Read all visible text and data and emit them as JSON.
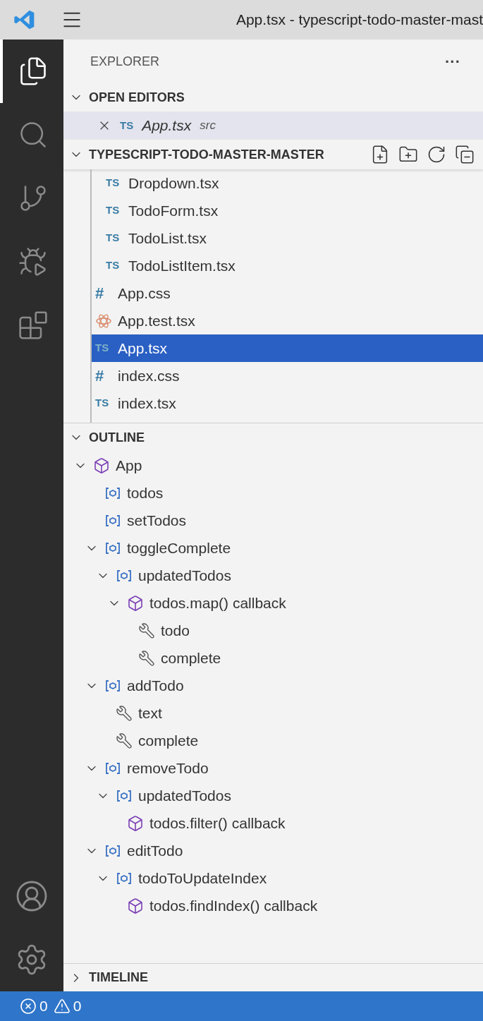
{
  "title_bar": {
    "title": "App.tsx - typescript-todo-master-mast"
  },
  "activity_bar": [
    {
      "kind": "explorer",
      "selected": true
    },
    {
      "kind": "search",
      "selected": false
    },
    {
      "kind": "scm",
      "selected": false
    },
    {
      "kind": "debug",
      "selected": false
    },
    {
      "kind": "extensions",
      "selected": false
    }
  ],
  "activity_bar_bottom": [
    {
      "kind": "account"
    },
    {
      "kind": "settings"
    }
  ],
  "explorer": {
    "title": "EXPLORER",
    "more": "···",
    "open_editors": {
      "label": "OPEN EDITORS",
      "expanded": true,
      "items": [
        {
          "icon": "TS",
          "name": "App.tsx",
          "folder": "src",
          "selected": true
        }
      ]
    },
    "folder": {
      "label": "TYPESCRIPT-TODO-MASTER-MASTER",
      "expanded": true,
      "nested_files": [
        {
          "kind": "ts",
          "icon": "TS",
          "name": "Dropdown.tsx",
          "selected": false
        },
        {
          "kind": "ts",
          "icon": "TS",
          "name": "TodoForm.tsx",
          "selected": false
        },
        {
          "kind": "ts",
          "icon": "TS",
          "name": "TodoList.tsx",
          "selected": false
        },
        {
          "kind": "ts",
          "icon": "TS",
          "name": "TodoListItem.tsx",
          "selected": false
        }
      ],
      "files": [
        {
          "kind": "css",
          "icon": "#",
          "name": "App.css",
          "selected": false
        },
        {
          "kind": "test",
          "name": "App.test.tsx",
          "selected": false
        },
        {
          "kind": "ts",
          "icon": "TS",
          "name": "App.tsx",
          "selected": true
        },
        {
          "kind": "css",
          "icon": "#",
          "name": "index.css",
          "selected": false
        },
        {
          "kind": "ts",
          "icon": "TS",
          "name": "index.tsx",
          "selected": false
        }
      ]
    }
  },
  "outline": {
    "label": "OUTLINE",
    "expanded": true,
    "items": [
      {
        "kind": "module",
        "name": "App",
        "expanded": true,
        "children": [
          {
            "kind": "variable",
            "name": "todos"
          },
          {
            "kind": "variable",
            "name": "setTodos"
          },
          {
            "kind": "variable",
            "name": "toggleComplete",
            "expanded": true,
            "children": [
              {
                "kind": "variable",
                "name": "updatedTodos",
                "expanded": true,
                "children": [
                  {
                    "kind": "module",
                    "name": "todos.map() callback",
                    "expanded": true,
                    "children": [
                      {
                        "kind": "property",
                        "name": "todo"
                      },
                      {
                        "kind": "property",
                        "name": "complete"
                      }
                    ]
                  }
                ]
              }
            ]
          },
          {
            "kind": "variable",
            "name": "addTodo",
            "expanded": true,
            "children": [
              {
                "kind": "property",
                "name": "text"
              },
              {
                "kind": "property",
                "name": "complete"
              }
            ]
          },
          {
            "kind": "variable",
            "name": "removeTodo",
            "expanded": true,
            "children": [
              {
                "kind": "variable",
                "name": "updatedTodos",
                "expanded": true,
                "children": [
                  {
                    "kind": "module",
                    "name": "todos.filter() callback"
                  }
                ]
              }
            ]
          },
          {
            "kind": "variable",
            "name": "editTodo",
            "expanded": true,
            "children": [
              {
                "kind": "variable",
                "name": "todoToUpdateIndex",
                "expanded": true,
                "children": [
                  {
                    "kind": "module",
                    "name": "todos.findIndex() callback"
                  }
                ]
              }
            ]
          }
        ]
      }
    ]
  },
  "timeline": {
    "label": "TIMELINE",
    "expanded": false
  },
  "status_bar": {
    "errors": "0",
    "warnings": "0"
  }
}
